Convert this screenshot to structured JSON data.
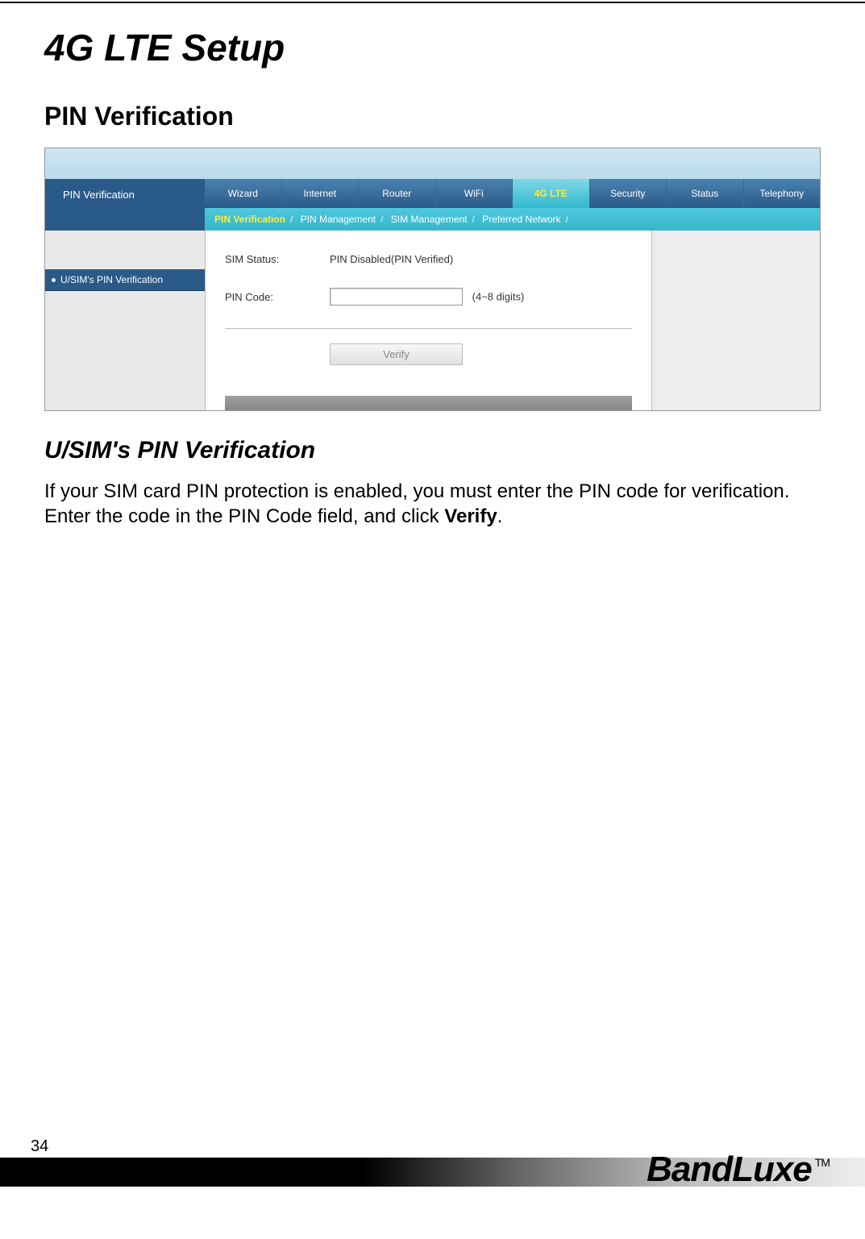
{
  "doc": {
    "main_heading": "4G LTE Setup",
    "section_heading": "PIN Verification",
    "sub_heading": "U/SIM's PIN Verification",
    "body_text_a": "If your SIM card PIN protection is enabled, you must enter the PIN code for verification. Enter the code in the PIN Code field, and click ",
    "body_text_bold": "Verify",
    "body_text_b": ".",
    "page_number": "34",
    "brand": "BandLuxe",
    "tm": "TM"
  },
  "ui": {
    "side_title": "PIN Verification",
    "tabs": [
      "Wizard",
      "Internet",
      "Router",
      "WiFi",
      "4G LTE",
      "Security",
      "Status",
      "Telephony"
    ],
    "active_tab_index": 4,
    "subnav": [
      "PIN Verification",
      "PIN Management",
      "SIM Management",
      "Preferred Network"
    ],
    "active_subnav_index": 0,
    "sidebar_item": "U/SIM's PIN Verification",
    "form": {
      "sim_status_label": "SIM Status:",
      "sim_status_value": "PIN Disabled(PIN Verified)",
      "pin_code_label": "PIN Code:",
      "pin_code_value": "",
      "pin_hint": "(4~8 digits)",
      "verify_button": "Verify"
    }
  }
}
